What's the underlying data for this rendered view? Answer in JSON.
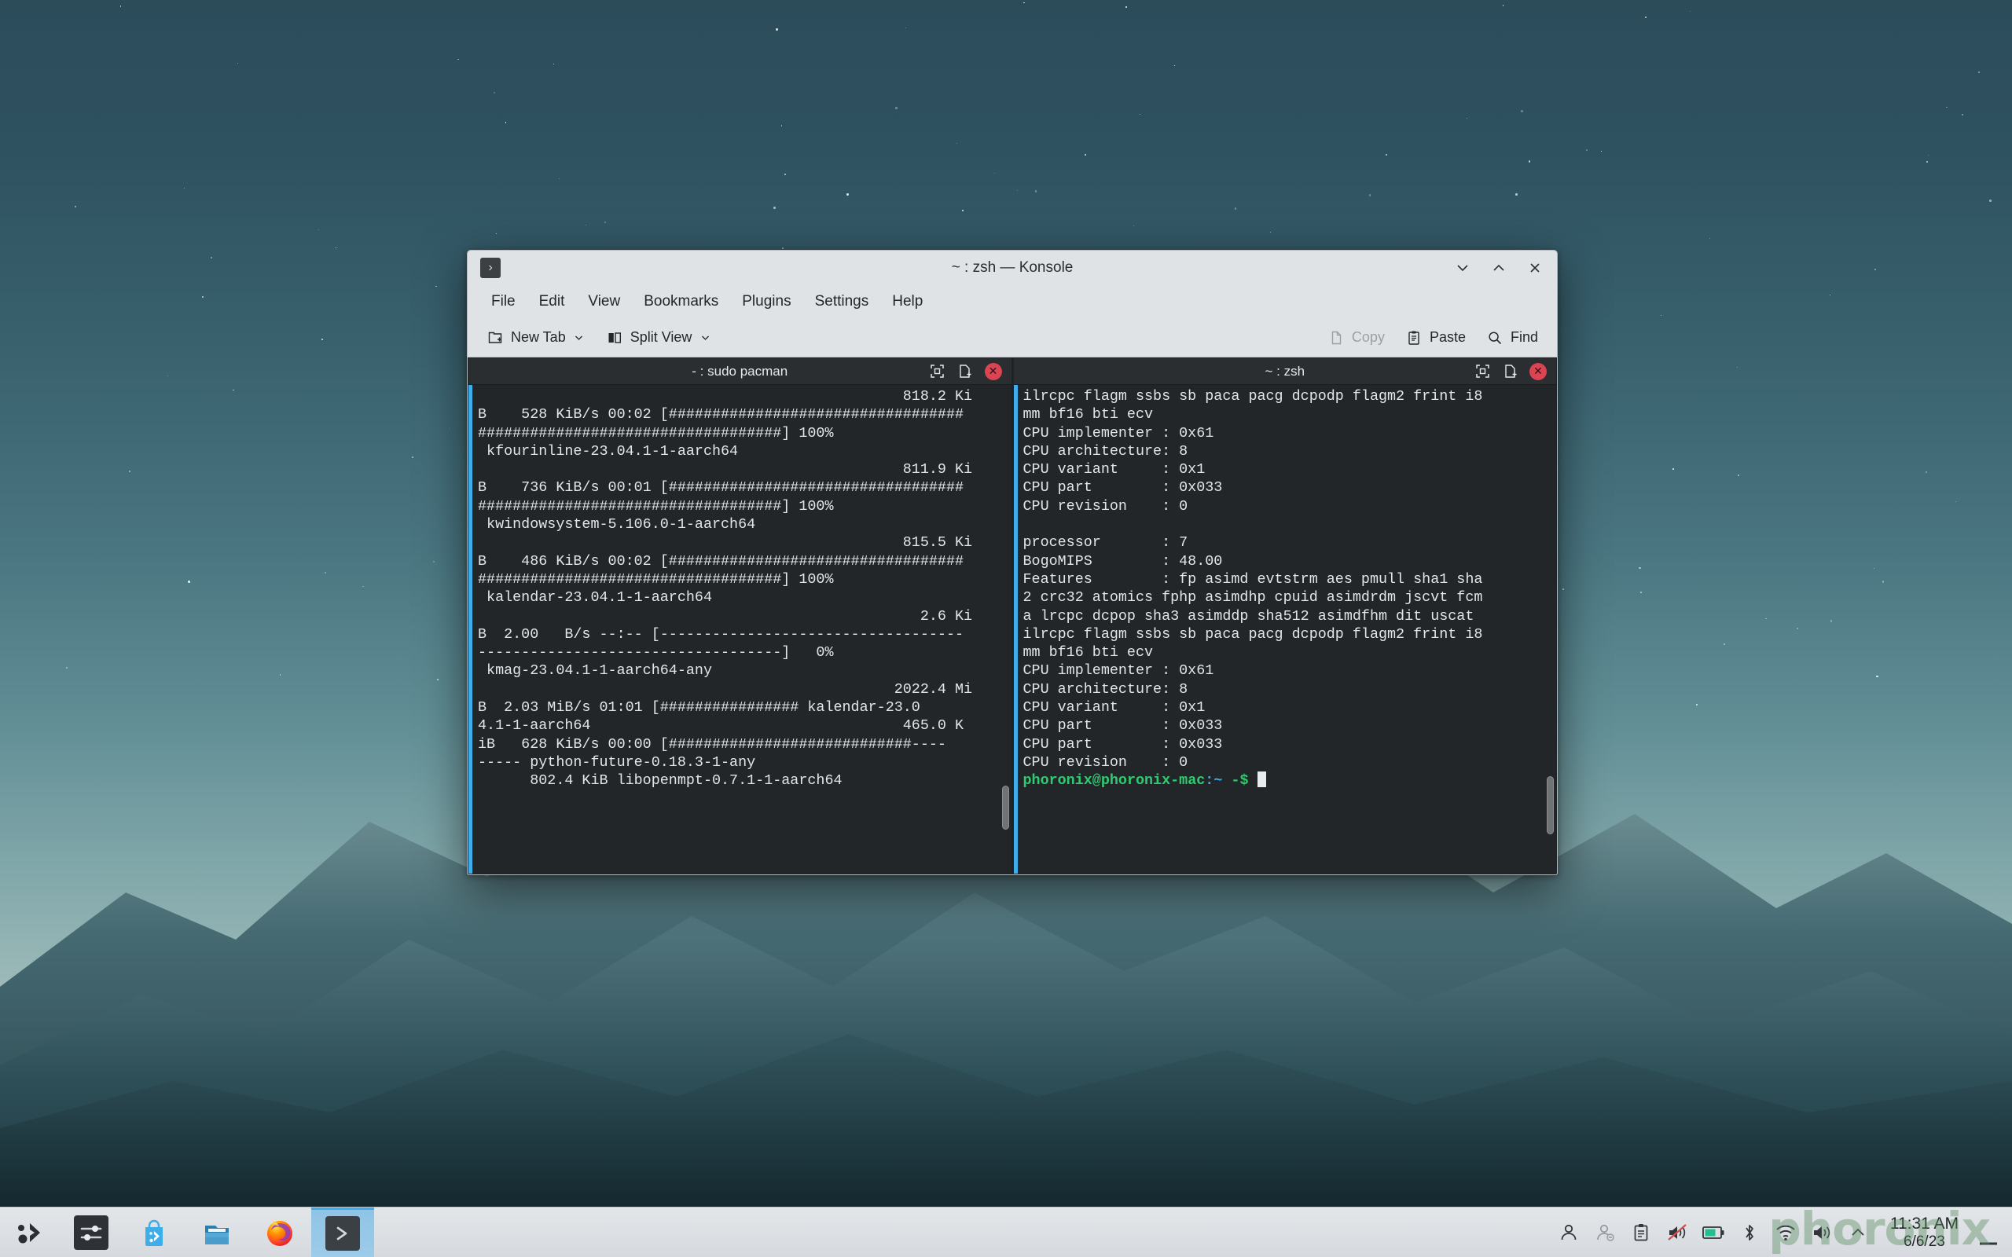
{
  "window": {
    "title": "~ : zsh — Konsole",
    "icon": "terminal-icon",
    "controls": [
      {
        "name": "minimize",
        "glyph": "chevron-down-icon"
      },
      {
        "name": "maximize",
        "glyph": "chevron-up-icon"
      },
      {
        "name": "close",
        "glyph": "close-icon"
      }
    ]
  },
  "menubar": {
    "items": [
      {
        "label": "File"
      },
      {
        "label": "Edit"
      },
      {
        "label": "View"
      },
      {
        "label": "Bookmarks"
      },
      {
        "label": "Plugins"
      },
      {
        "label": "Settings"
      },
      {
        "label": "Help"
      }
    ]
  },
  "toolbar": {
    "new_tab_label": "New Tab",
    "split_view_label": "Split View",
    "copy_label": "Copy",
    "paste_label": "Paste",
    "find_label": "Find"
  },
  "panes": [
    {
      "title": "- : sudo pacman",
      "active": false,
      "scroll_thumb_top_pct": 82,
      "scroll_thumb_height_pct": 9,
      "content": "                                                 818.2 Ki\nB    528 KiB/s 00:02 [##################################\n###################################] 100%\n kfourinline-23.04.1-1-aarch64\n                                                 811.9 Ki\nB    736 KiB/s 00:01 [##################################\n###################################] 100%\n kwindowsystem-5.106.0-1-aarch64\n                                                 815.5 Ki\nB    486 KiB/s 00:02 [##################################\n###################################] 100%\n kalendar-23.04.1-1-aarch64\n                                                   2.6 Ki\nB  2.00   B/s --:-- [-----------------------------------\n-----------------------------------]   0%\n kmag-23.04.1-1-aarch64-any\n                                                2022.4 Mi\nB  2.03 MiB/s 01:01 [################ kalendar-23.0\n4.1-1-aarch64                                    465.0 K\niB   628 KiB/s 00:00 [############################----\n----- python-future-0.18.3-1-any\n      802.4 KiB libopenmpt-0.7.1-1-aarch64"
    },
    {
      "title": "~ : zsh",
      "active": true,
      "scroll_thumb_top_pct": 80,
      "scroll_thumb_height_pct": 12,
      "content": "ilrcpc flagm ssbs sb paca pacg dcpodp flagm2 frint i8\nmm bf16 bti ecv\nCPU implementer : 0x61\nCPU architecture: 8\nCPU variant     : 0x1\nCPU part        : 0x033\nCPU revision    : 0\n\nprocessor       : 7\nBogoMIPS        : 48.00\nFeatures        : fp asimd evtstrm aes pmull sha1 sha\n2 crc32 atomics fphp asimdhp cpuid asimdrdm jscvt fcm\na lrcpc dcpop sha3 asimddp sha512 asimdfhm dit uscat\nilrcpc flagm ssbs sb paca pacg dcpodp flagm2 frint i8\nmm bf16 bti ecv\nCPU implementer : 0x61\nCPU architecture: 8\nCPU variant     : 0x1\nCPU part        : 0x033\nCPU part        : 0x033\nCPU revision    : 0\n",
      "prompt": {
        "user": "phoronix",
        "at": "@",
        "host": "phoronix-mac",
        "colon": ":",
        "path": "~",
        "dollar": "-$"
      }
    }
  ],
  "pane_buttons": {
    "maximize_name": "maximize-pane-icon",
    "split_name": "new-split-icon",
    "close_name": "close-pane-icon"
  },
  "taskbar": {
    "launcher_name": "kde-application-launcher",
    "apps": [
      {
        "name": "system-settings",
        "label": "System Settings"
      },
      {
        "name": "discover-software-center",
        "label": "Discover"
      },
      {
        "name": "dolphin-file-manager",
        "label": "Dolphin"
      },
      {
        "name": "firefox-browser",
        "label": "Firefox"
      },
      {
        "name": "konsole-terminal",
        "label": "Konsole",
        "active": true
      }
    ],
    "tray": [
      {
        "name": "user-account-icon"
      },
      {
        "name": "user-away-icon"
      },
      {
        "name": "clipboard-icon"
      },
      {
        "name": "volume-muted-icon"
      },
      {
        "name": "battery-icon"
      },
      {
        "name": "bluetooth-icon"
      },
      {
        "name": "wifi-icon"
      },
      {
        "name": "audio-volume-icon"
      },
      {
        "name": "show-hidden-icons-icon"
      }
    ],
    "clock": {
      "time": "11:31 AM",
      "date": "6/6/23"
    },
    "show_desktop_name": "show-desktop-button"
  },
  "watermark": {
    "text": "phoronix"
  },
  "colors": {
    "accent": "#3daee9",
    "close_red": "#da4453",
    "prompt_green": "#2ecc71",
    "terminal_bg": "#232629",
    "chrome_bg": "#dfe3e6"
  }
}
